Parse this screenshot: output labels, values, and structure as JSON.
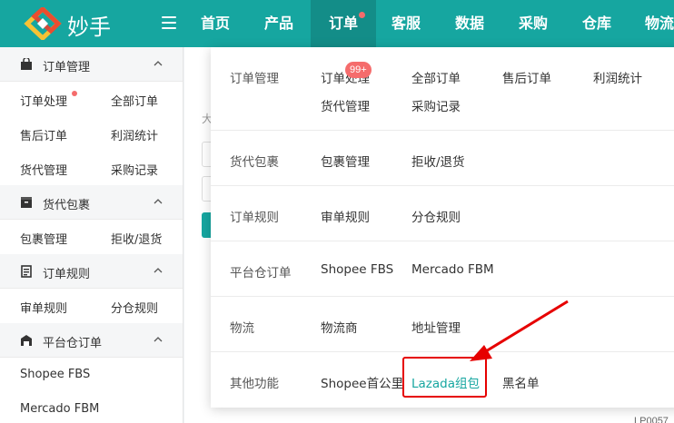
{
  "header": {
    "logo_text": "妙手",
    "nav": [
      {
        "label": "首页",
        "active": false
      },
      {
        "label": "产品",
        "active": false
      },
      {
        "label": "订单",
        "active": true
      },
      {
        "label": "客服",
        "active": false
      },
      {
        "label": "数据",
        "active": false
      },
      {
        "label": "采购",
        "active": false
      },
      {
        "label": "仓库",
        "active": false
      },
      {
        "label": "物流",
        "active": false
      }
    ]
  },
  "sidebar": {
    "groups": [
      {
        "title": "订单管理",
        "icon": "shopping-bag-icon",
        "items": [
          "订单处理",
          "全部订单",
          "售后订单",
          "利润统计",
          "货代管理",
          "采购记录"
        ]
      },
      {
        "title": "货代包裹",
        "icon": "package-icon",
        "items": [
          "包裹管理",
          "拒收/退货"
        ]
      },
      {
        "title": "订单规则",
        "icon": "list-icon",
        "items": [
          "审单规则",
          "分仓规则"
        ]
      },
      {
        "title": "平台仓订单",
        "icon": "warehouse-icon",
        "items": [
          "Shopee FBS",
          "Mercado FBM"
        ]
      }
    ]
  },
  "main": {
    "hint_char": "大",
    "code_fragment": "LP0057"
  },
  "dropdown": {
    "badge": "99+",
    "rows": [
      {
        "category": "订单管理",
        "links": [
          "订单处理",
          "全部订单",
          "售后订单",
          "利润统计",
          "货代管理",
          "采购记录"
        ]
      },
      {
        "category": "货代包裹",
        "links": [
          "包裹管理",
          "拒收/退货"
        ]
      },
      {
        "category": "订单规则",
        "links": [
          "审单规则",
          "分仓规则"
        ]
      },
      {
        "category": "平台仓订单",
        "links": [
          "Shopee FBS",
          "Mercado FBM"
        ]
      },
      {
        "category": "物流",
        "links": [
          "物流商",
          "地址管理"
        ]
      },
      {
        "category": "其他功能",
        "links": [
          "Shopee首公里",
          "Lazada组包",
          "黑名单"
        ]
      }
    ]
  },
  "colors": {
    "brand": "#16a6a0",
    "active_nav": "#138d88",
    "highlight": "#e60000",
    "dot": "#f56c6c"
  }
}
